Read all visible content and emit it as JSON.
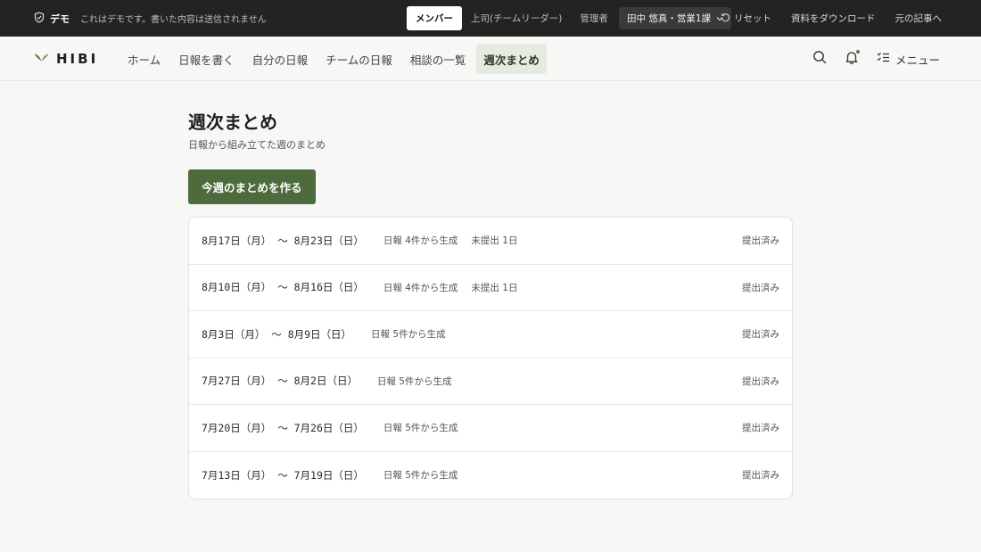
{
  "demo_bar": {
    "label": "デモ",
    "message": "これはデモです。書いた内容は送信されません",
    "roles": [
      "メンバー",
      "上司(チームリーダー)",
      "管理者"
    ],
    "active_role": "メンバー",
    "user": "田中 悠真・営業1課",
    "reset": "リセット",
    "download": "資料をダウンロード",
    "original": "元の記事へ"
  },
  "header": {
    "logo": "HIBI",
    "nav": [
      "ホーム",
      "日報を書く",
      "自分の日報",
      "チームの日報",
      "相談の一覧",
      "週次まとめ"
    ],
    "active_nav": "週次まとめ",
    "menu_label": "メニュー"
  },
  "main": {
    "title": "週次まとめ",
    "subtitle": "日報から組み立てた週のまとめ",
    "create_button": "今週のまとめを作る",
    "summaries": [
      {
        "range": "8月17日（月） 〜 8月23日（日）",
        "count": "日報 4件から生成",
        "missing": "未提出 1日",
        "status": "提出済み"
      },
      {
        "range": "8月10日（月） 〜 8月16日（日）",
        "count": "日報 4件から生成",
        "missing": "未提出 1日",
        "status": "提出済み"
      },
      {
        "range": "8月3日（月） 〜 8月9日（日）",
        "count": "日報 5件から生成",
        "missing": "",
        "status": "提出済み"
      },
      {
        "range": "7月27日（月） 〜 8月2日（日）",
        "count": "日報 5件から生成",
        "missing": "",
        "status": "提出済み"
      },
      {
        "range": "7月20日（月） 〜 7月26日（日）",
        "count": "日報 5件から生成",
        "missing": "",
        "status": "提出済み"
      },
      {
        "range": "7月13日（月） 〜 7月19日（日）",
        "count": "日報 5件から生成",
        "missing": "",
        "status": "提出済み"
      }
    ]
  },
  "colors": {
    "accent": "#4d6b3c",
    "active_nav_bg": "#e6ebe1",
    "demo_bar_bg": "#232323"
  },
  "icons": [
    "shield-icon",
    "chevron-down-icon",
    "reset-icon",
    "leaf-logo-icon",
    "search-icon",
    "bell-icon",
    "checklist-icon"
  ]
}
